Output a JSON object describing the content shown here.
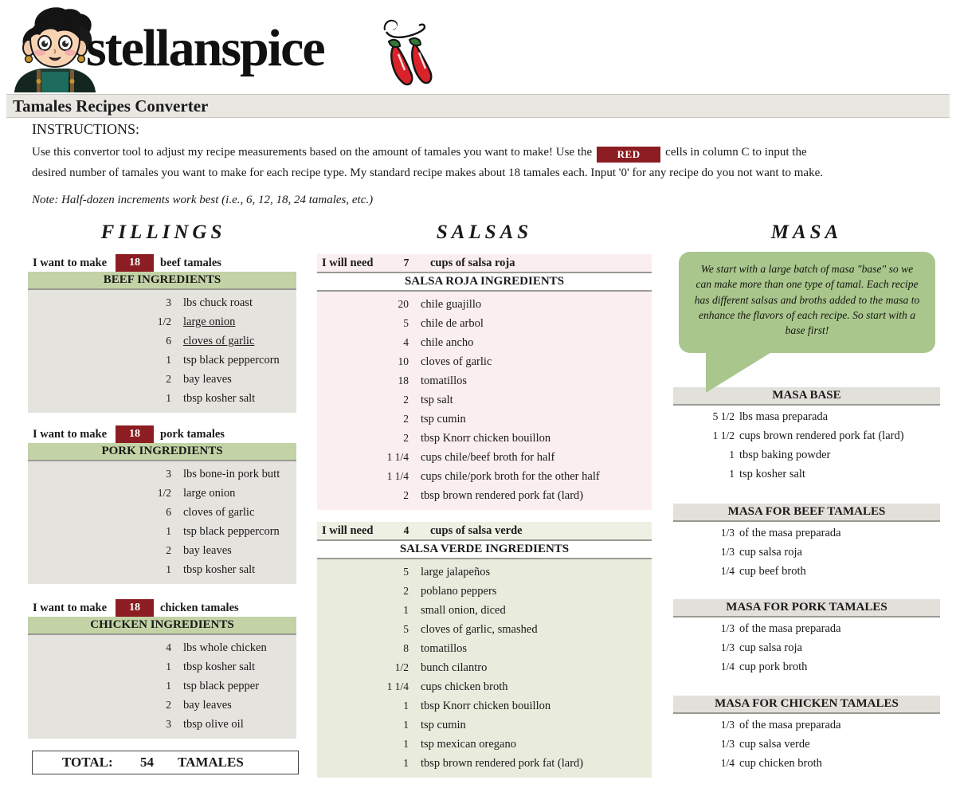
{
  "brand": {
    "wordmark": "stellanspice",
    "mascot_icon": "girl-mascot-icon",
    "chiles_icon": "chili-peppers-icon"
  },
  "header": {
    "title": "Tamales Recipes Converter",
    "title_bar_color": "#e9e7e2"
  },
  "instructions": {
    "heading": "INSTRUCTIONS:",
    "line1_before": "Use this convertor tool to adjust my recipe measurements based on the amount of tamales you want to make! Use the",
    "red_chip": "RED",
    "line1_after": "cells in column C to input the",
    "line2": "desired number of tamales you want to make for each recipe type. My standard recipe makes about 18 tamales each. Input '0' for any recipe do you not want to make.",
    "note": "Note: Half-dozen increments work best (i.e., 6, 12, 18, 24 tamales, etc.)"
  },
  "colors": {
    "red_input": "#8c1d22",
    "green_header": "#c3d3a6",
    "gray_header": "#e2e0db",
    "filling_body": "#e5e3de",
    "salsa_roja_body": "#fbeeee",
    "salsa_verde_body": "#e9ecdd",
    "bubble_green": "#a9c78d"
  },
  "columns": {
    "fillings_title": "FILLINGS",
    "salsas_title": "SALSAS",
    "masa_title": "MASA"
  },
  "fillings": [
    {
      "want_label_pre": "I want to make",
      "quantity": "18",
      "want_label_post": "beef tamales",
      "section_header": "BEEF INGREDIENTS",
      "ingredients": [
        {
          "qty": "3",
          "text": "lbs chuck roast",
          "underline": false
        },
        {
          "qty": "1/2",
          "text": "large onion",
          "underline": true
        },
        {
          "qty": "6",
          "text": "cloves of garlic",
          "underline": true
        },
        {
          "qty": "1",
          "text": "tsp black peppercorn",
          "underline": false
        },
        {
          "qty": "2",
          "text": "bay leaves",
          "underline": false
        },
        {
          "qty": "1",
          "text": "tbsp kosher salt",
          "underline": false
        }
      ]
    },
    {
      "want_label_pre": "I want to make",
      "quantity": "18",
      "want_label_post": "pork tamales",
      "section_header": "PORK INGREDIENTS",
      "ingredients": [
        {
          "qty": "3",
          "text": "lbs bone-in pork butt",
          "underline": false
        },
        {
          "qty": "1/2",
          "text": "large onion",
          "underline": false
        },
        {
          "qty": "6",
          "text": "cloves of garlic",
          "underline": false
        },
        {
          "qty": "1",
          "text": "tsp black peppercorn",
          "underline": false
        },
        {
          "qty": "2",
          "text": "bay leaves",
          "underline": false
        },
        {
          "qty": "1",
          "text": "tbsp kosher salt",
          "underline": false
        }
      ]
    },
    {
      "want_label_pre": "I want to make",
      "quantity": "18",
      "want_label_post": "chicken tamales",
      "section_header": "CHICKEN INGREDIENTS",
      "ingredients": [
        {
          "qty": "4",
          "text": "lbs whole chicken",
          "underline": false
        },
        {
          "qty": "1",
          "text": "tbsp kosher salt",
          "underline": false
        },
        {
          "qty": "1",
          "text": "tsp black pepper",
          "underline": false
        },
        {
          "qty": "2",
          "text": "bay leaves",
          "underline": false
        },
        {
          "qty": "3",
          "text": "tbsp olive oil",
          "underline": false
        }
      ]
    }
  ],
  "total": {
    "label": "TOTAL:",
    "value": "54",
    "unit": "TAMALES"
  },
  "salsas": [
    {
      "need_label_pre": "I will need",
      "quantity": "7",
      "need_label_post": "cups of salsa roja",
      "section_header": "SALSA ROJA INGREDIENTS",
      "ingredients": [
        {
          "qty": "20",
          "text": "chile guajillo"
        },
        {
          "qty": "5",
          "text": "chile de arbol"
        },
        {
          "qty": "4",
          "text": "chile ancho"
        },
        {
          "qty": "10",
          "text": "cloves of garlic"
        },
        {
          "qty": "18",
          "text": "tomatillos"
        },
        {
          "qty": "2",
          "text": "tsp salt"
        },
        {
          "qty": "2",
          "text": "tsp cumin"
        },
        {
          "qty": "2",
          "text": "tbsp Knorr chicken bouillon"
        },
        {
          "qty": "1 1/4",
          "text": "cups chile/beef broth for half"
        },
        {
          "qty": "1 1/4",
          "text": "cups chile/pork broth for the other half"
        },
        {
          "qty": "2",
          "text": "tbsp brown rendered pork fat (lard)"
        }
      ]
    },
    {
      "need_label_pre": "I will need",
      "quantity": "4",
      "need_label_post": "cups of salsa verde",
      "section_header": "SALSA VERDE INGREDIENTS",
      "ingredients": [
        {
          "qty": "5",
          "text": "large jalapeños"
        },
        {
          "qty": "2",
          "text": "poblano peppers"
        },
        {
          "qty": "1",
          "text": "small onion, diced"
        },
        {
          "qty": "5",
          "text": "cloves of garlic, smashed"
        },
        {
          "qty": "8",
          "text": "tomatillos"
        },
        {
          "qty": "1/2",
          "text": "bunch cilantro"
        },
        {
          "qty": "1 1/4",
          "text": "cups chicken broth"
        },
        {
          "qty": "1",
          "text": "tbsp Knorr chicken bouillon"
        },
        {
          "qty": "1",
          "text": "tsp cumin"
        },
        {
          "qty": "1",
          "text": "tsp mexican oregano"
        },
        {
          "qty": "1",
          "text": "tbsp brown rendered pork fat (lard)"
        }
      ]
    }
  ],
  "masa_bubble": "We start with a large batch of masa \"base\" so we can make more than one type of tamal. Each recipe has different salsas and broths added to the masa to enhance the flavors of each recipe. So start with a base first!",
  "masa": [
    {
      "section_header": "MASA BASE",
      "ingredients": [
        {
          "qty": "5 1/2",
          "text": "lbs masa preparada"
        },
        {
          "qty": "1 1/2",
          "text": "cups brown rendered pork fat (lard)"
        },
        {
          "qty": "1",
          "text": "tbsp baking powder"
        },
        {
          "qty": "1",
          "text": "tsp kosher salt"
        }
      ]
    },
    {
      "section_header": "MASA FOR BEEF TAMALES",
      "ingredients": [
        {
          "qty": "1/3",
          "text": "of the masa preparada"
        },
        {
          "qty": "1/3",
          "text": "cup salsa roja"
        },
        {
          "qty": "1/4",
          "text": "cup beef broth"
        }
      ]
    },
    {
      "section_header": "MASA FOR PORK TAMALES",
      "ingredients": [
        {
          "qty": "1/3",
          "text": "of the masa preparada"
        },
        {
          "qty": "1/3",
          "text": "cup salsa roja"
        },
        {
          "qty": "1/4",
          "text": "cup pork broth"
        }
      ]
    },
    {
      "section_header": "MASA FOR CHICKEN TAMALES",
      "ingredients": [
        {
          "qty": "1/3",
          "text": "of the masa preparada"
        },
        {
          "qty": "1/3",
          "text": "cup salsa verde"
        },
        {
          "qty": "1/4",
          "text": "cup chicken broth"
        }
      ]
    }
  ]
}
